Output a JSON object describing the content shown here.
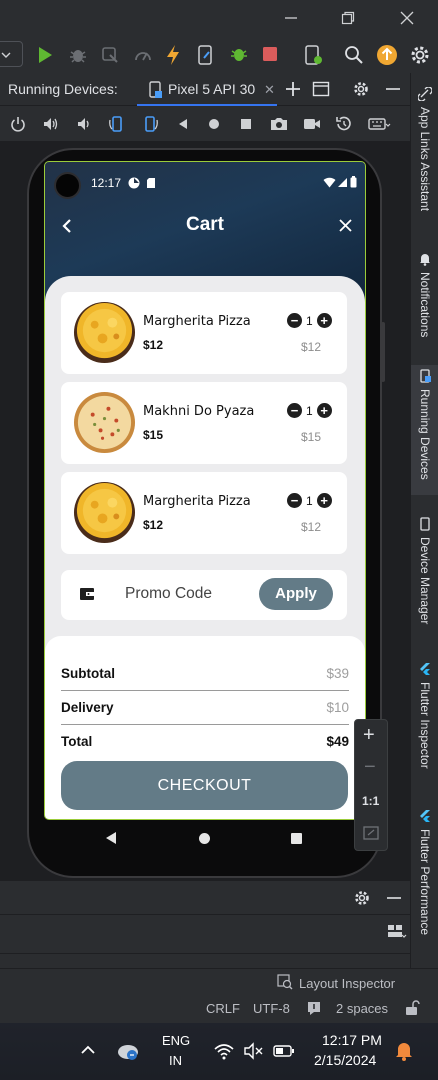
{
  "ide": {
    "running_devices_label": "Running Devices:",
    "device_tab": "Pixel 5 API 30",
    "right_tabs": [
      "App Links Assistant",
      "Notifications",
      "Running Devices",
      "Device Manager",
      "Flutter Inspector",
      "Flutter Performance"
    ],
    "zoom": {
      "plus": "+",
      "minus": "−",
      "one_to_one": "1:1"
    },
    "status": {
      "layout_inspector": "Layout Inspector",
      "line_sep": "CRLF",
      "encoding": "UTF-8",
      "indent": "2 spaces"
    }
  },
  "taskbar": {
    "lang_line1": "ENG",
    "lang_line2": "IN",
    "time": "12:17 PM",
    "date": "2/15/2024"
  },
  "phone": {
    "status_time": "12:17",
    "title": "Cart",
    "items": [
      {
        "name": "Margherita Pizza",
        "price": "$12",
        "qty": "1",
        "line_total": "$12",
        "kind": "margherita"
      },
      {
        "name": "Makhni Do Pyaza",
        "price": "$15",
        "qty": "1",
        "line_total": "$15",
        "kind": "makhni"
      },
      {
        "name": "Margherita Pizza",
        "price": "$12",
        "qty": "1",
        "line_total": "$12",
        "kind": "margherita"
      }
    ],
    "promo": {
      "label": "Promo Code",
      "apply": "Apply"
    },
    "summary": {
      "subtotal_label": "Subtotal",
      "subtotal": "$39",
      "delivery_label": "Delivery",
      "delivery": "$10",
      "total_label": "Total",
      "total": "$49"
    },
    "checkout": "CHECKOUT"
  },
  "colors": {
    "accent": "#637b87",
    "ide_bg": "#2b2d30",
    "run_green": "#5fb832",
    "stop_red": "#db5c5c",
    "update_orange": "#f0a732"
  }
}
